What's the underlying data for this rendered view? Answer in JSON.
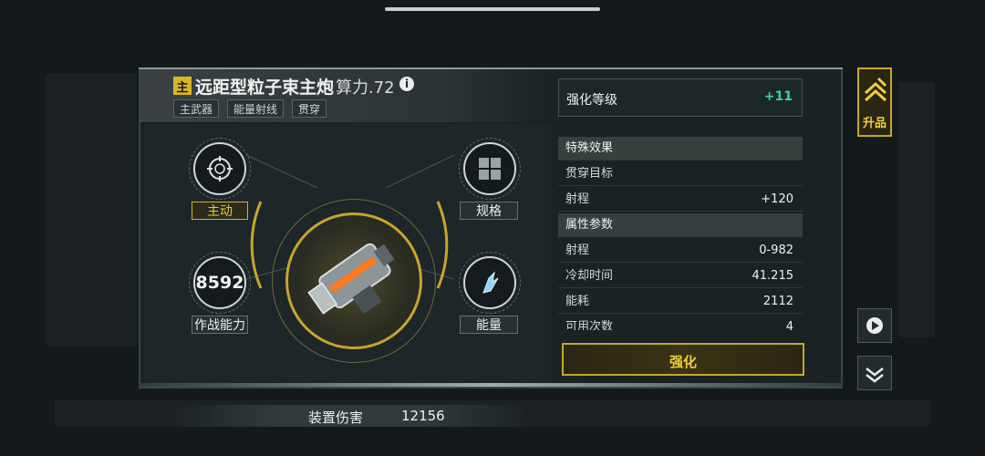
{
  "weapon": {
    "main_badge": "主",
    "name": "远距型粒子束主炮",
    "power": "算力.72",
    "info_glyph": "i",
    "tags": [
      "主武器",
      "能量射线",
      "贯穿"
    ]
  },
  "left_panel": {
    "active_label": "主动",
    "spec_label": "规格",
    "combat_value": "8592",
    "combat_label": "作战能力",
    "energy_label": "能量",
    "damage_label": "装置伤害",
    "damage_value": "12156"
  },
  "enhance": {
    "label": "强化等级",
    "value": "+11"
  },
  "special_effects": {
    "title": "特殊效果",
    "rows": [
      {
        "label": "贯穿目标",
        "value": ""
      },
      {
        "label": "射程",
        "value": "+120"
      }
    ]
  },
  "attributes": {
    "title": "属性参数",
    "rows": [
      {
        "label": "射程",
        "value": "0-982"
      },
      {
        "label": "冷却时间",
        "value": "41.215"
      },
      {
        "label": "能耗",
        "value": "2112"
      },
      {
        "label": "可用次数",
        "value": "4"
      }
    ]
  },
  "buttons": {
    "strengthen": "强化",
    "upgrade": "升品"
  },
  "colors": {
    "accent_gold": "#d9b52a",
    "accent_green": "#3fd1a6"
  }
}
